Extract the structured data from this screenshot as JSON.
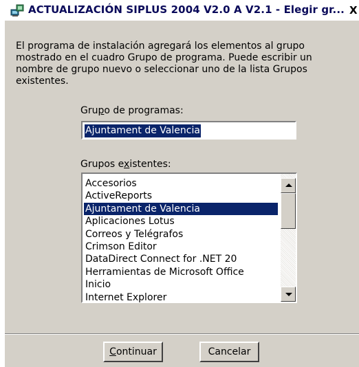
{
  "window": {
    "title": "ACTUALIZACIÓN SIPLUS 2004 V2.0 A V2.1 - Elegir gr...",
    "close_label": "X",
    "icon": "setup-computer-icon"
  },
  "description": "El programa de instalación agregará los elementos al grupo mostrado en el cuadro Grupo de programa. Puede escribir un nombre de grupo nuevo o seleccionar uno de la lista Grupos existentes.",
  "program_group": {
    "label_pre": "Gru",
    "label_accel": "p",
    "label_post": "o de programas:",
    "value": "Ajuntament de Valencia"
  },
  "existing_groups": {
    "label_pre": "Grupos e",
    "label_accel": "x",
    "label_post": "istentes:",
    "items": [
      "Accesorios",
      "ActiveReports",
      "Ajuntament de Valencia",
      "Aplicaciones Lotus",
      "Correos y Telégrafos",
      "Crimson Editor",
      "DataDirect Connect for .NET 20",
      "Herramientas de Microsoft Office",
      "Inicio",
      "Internet Explorer"
    ],
    "selected_index": 2
  },
  "buttons": {
    "continue_accel": "C",
    "continue_rest": "ontinuar",
    "cancel": "Cancelar"
  },
  "colors": {
    "dialog_bg": "#d4d0c8",
    "selection_bg": "#0a246a",
    "title_text": "#0a0a5a"
  }
}
